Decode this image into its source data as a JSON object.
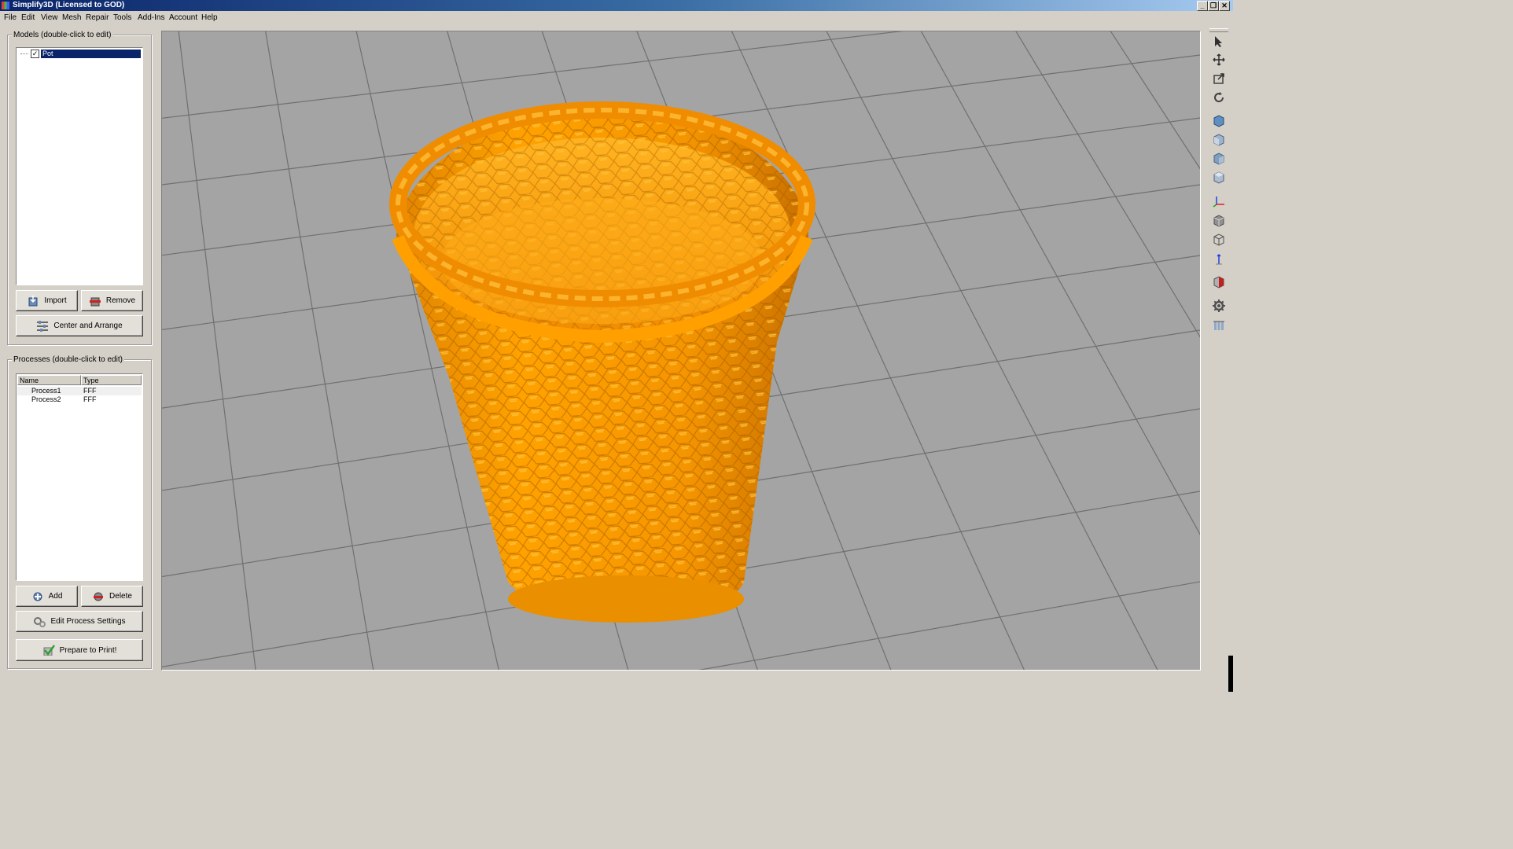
{
  "window": {
    "title": "Simplify3D (Licensed to GOD)"
  },
  "menu": [
    "File",
    "Edit",
    "View",
    "Mesh",
    "Repair",
    "Tools",
    "Add-Ins",
    "Account",
    "Help"
  ],
  "models_panel": {
    "title": "Models (double-click to edit)",
    "items": [
      {
        "name": "Pot",
        "checked": true,
        "selected": true
      }
    ],
    "import_label": "Import",
    "remove_label": "Remove",
    "center_arrange_label": "Center and Arrange"
  },
  "processes_panel": {
    "title": "Processes (double-click to edit)",
    "columns": [
      "Name",
      "Type"
    ],
    "rows": [
      {
        "name": "Process1",
        "type": "FFF"
      },
      {
        "name": "Process2",
        "type": "FFF"
      }
    ],
    "add_label": "Add",
    "delete_label": "Delete",
    "edit_settings_label": "Edit Process Settings",
    "prepare_label": "Prepare to Print!"
  },
  "viewport": {
    "model_color": "#ffa100",
    "bed_color": "#a0a0a0",
    "grid_color": "#6e6e6e"
  },
  "toolbar_icons": [
    "select-icon",
    "move-icon",
    "scale-icon",
    "rotate-icon",
    "view-default-icon",
    "view-front-icon",
    "view-side-icon",
    "view-top-icon",
    "axes-icon",
    "solid-view-icon",
    "wireframe-view-icon",
    "z-axis-icon",
    "cross-section-icon",
    "settings-gear-icon",
    "columns-icon"
  ]
}
